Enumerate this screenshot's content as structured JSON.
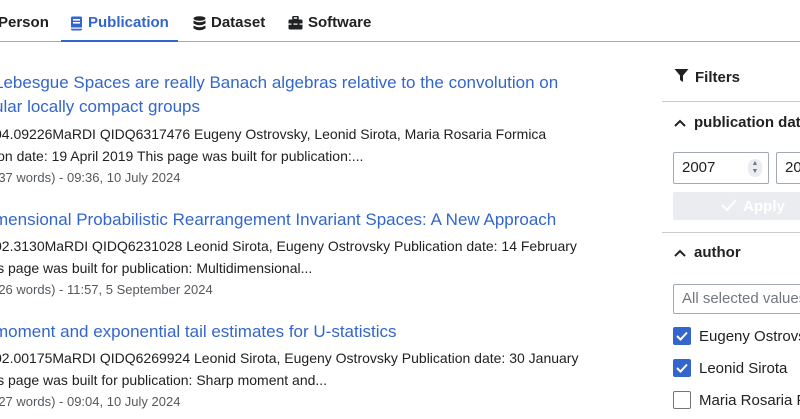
{
  "tabs": [
    {
      "label": "Person",
      "icon": "person-icon"
    },
    {
      "label": "Publication",
      "icon": "book-icon",
      "active": true
    },
    {
      "label": "Dataset",
      "icon": "database-icon"
    },
    {
      "label": "Software",
      "icon": "toolbox-icon"
    }
  ],
  "results": [
    {
      "title_line1": "Lebesgue Spaces are really Banach algebras relative to the convolution on",
      "title_line2": "ular locally compact groups",
      "snippet_line1": "04.09226MaRDI QIDQ6317476 Eugeny Ostrovsky, Leonid Sirota, Maria Rosaria Formica",
      "snippet_line2": "ion date: 19 April 2019 This page was built for publication:...",
      "meta": "(37 words) - 09:36, 10 July 2024"
    },
    {
      "title_line1": "mensional Probabilistic Rearrangement Invariant Spaces: A New Approach",
      "snippet_line1": "02.3130MaRDI QIDQ6231028 Leonid Sirota, Eugeny Ostrovsky Publication date: 14 February",
      "snippet_line2": "is page was built for publication: Multidimensional...",
      "meta": "(26 words) - 11:57, 5 September 2024"
    },
    {
      "title_line1": "moment and exponential tail estimates for U-statistics",
      "snippet_line1": "02.00175MaRDI QIDQ6269924 Leonid Sirota, Eugeny Ostrovsky Publication date: 30 January",
      "snippet_line2": "is page was built for publication: Sharp moment and...",
      "meta": "(27 words) - 09:04, 10 July 2024"
    }
  ],
  "filters": {
    "heading": "Filters",
    "publication_date": {
      "label": "publication dat",
      "from_value": "2007",
      "to_value": "20",
      "apply_label": "Apply"
    },
    "author": {
      "label": "author",
      "select_placeholder": "All selected values",
      "options": [
        {
          "label": "Eugeny Ostrovs",
          "checked": true
        },
        {
          "label": "Leonid Sirota",
          "checked": true
        },
        {
          "label": "Maria Rosaria F",
          "checked": false
        }
      ]
    }
  },
  "colors": {
    "link": "#3366cc",
    "text": "#202122",
    "meta": "#54595d",
    "border": "#a2a9b1",
    "checkbox": "#3366cc"
  }
}
